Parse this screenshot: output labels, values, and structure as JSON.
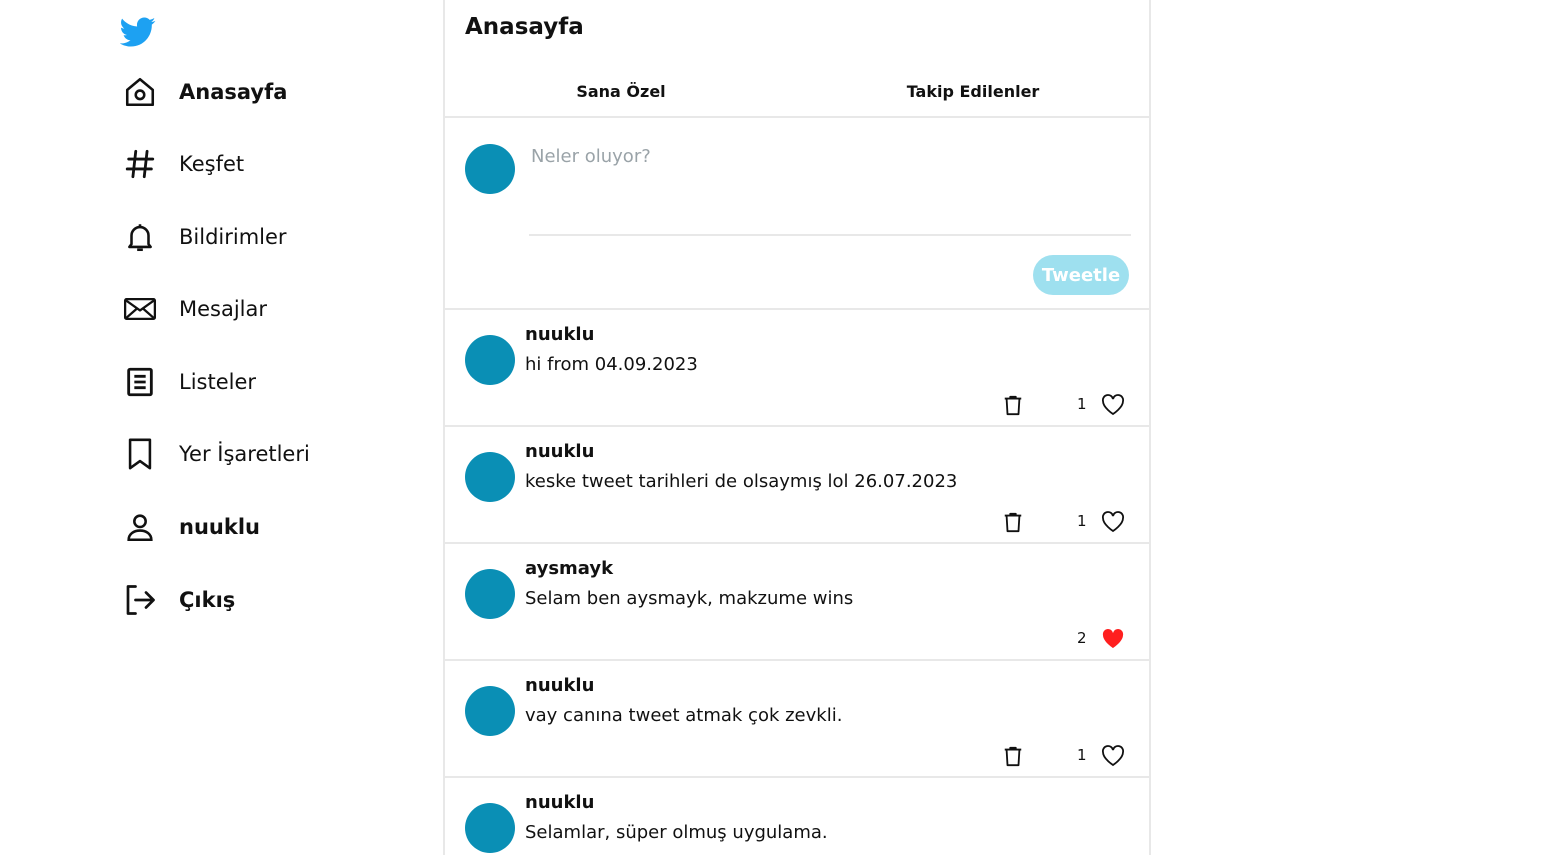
{
  "sidebar": {
    "logo_icon": "twitter-bird-icon",
    "brand_color": "#1da1f2",
    "items": [
      {
        "label": "Anasayfa",
        "icon": "home-icon",
        "bold": true
      },
      {
        "label": "Keşfet",
        "icon": "hashtag-icon",
        "bold": false
      },
      {
        "label": "Bildirimler",
        "icon": "bell-icon",
        "bold": false
      },
      {
        "label": "Mesajlar",
        "icon": "envelope-icon",
        "bold": false
      },
      {
        "label": "Listeler",
        "icon": "list-icon",
        "bold": false
      },
      {
        "label": "Yer İşaretleri",
        "icon": "bookmark-icon",
        "bold": false
      },
      {
        "label": "nuuklu",
        "icon": "user-icon",
        "bold": true
      },
      {
        "label": "Çıkış",
        "icon": "logout-icon",
        "bold": true
      }
    ]
  },
  "main": {
    "title": "Anasayfa",
    "tabs": [
      {
        "label": "Sana Özel"
      },
      {
        "label": "Takip Edilenler"
      }
    ],
    "composer": {
      "placeholder": "Neler oluyor?",
      "button_label": "Tweetle",
      "avatar_color": "#0a8fb5",
      "button_color": "#9ee0ef"
    },
    "tweets": [
      {
        "author": "nuuklu",
        "text": "hi from 04.09.2023",
        "likes": "1",
        "liked": false,
        "can_delete": true
      },
      {
        "author": "nuuklu",
        "text": "keske tweet tarihleri de olsaymış lol 26.07.2023",
        "likes": "1",
        "liked": false,
        "can_delete": true
      },
      {
        "author": "aysmayk",
        "text": "Selam ben aysmayk, makzume wins",
        "likes": "2",
        "liked": true,
        "can_delete": false
      },
      {
        "author": "nuuklu",
        "text": "vay canına tweet atmak çok zevkli.",
        "likes": "1",
        "liked": false,
        "can_delete": true
      },
      {
        "author": "nuuklu",
        "text": "Selamlar, süper olmuş uygulama.",
        "likes": "",
        "liked": false,
        "can_delete": false
      }
    ],
    "liked_color": "#ff1f1f"
  }
}
